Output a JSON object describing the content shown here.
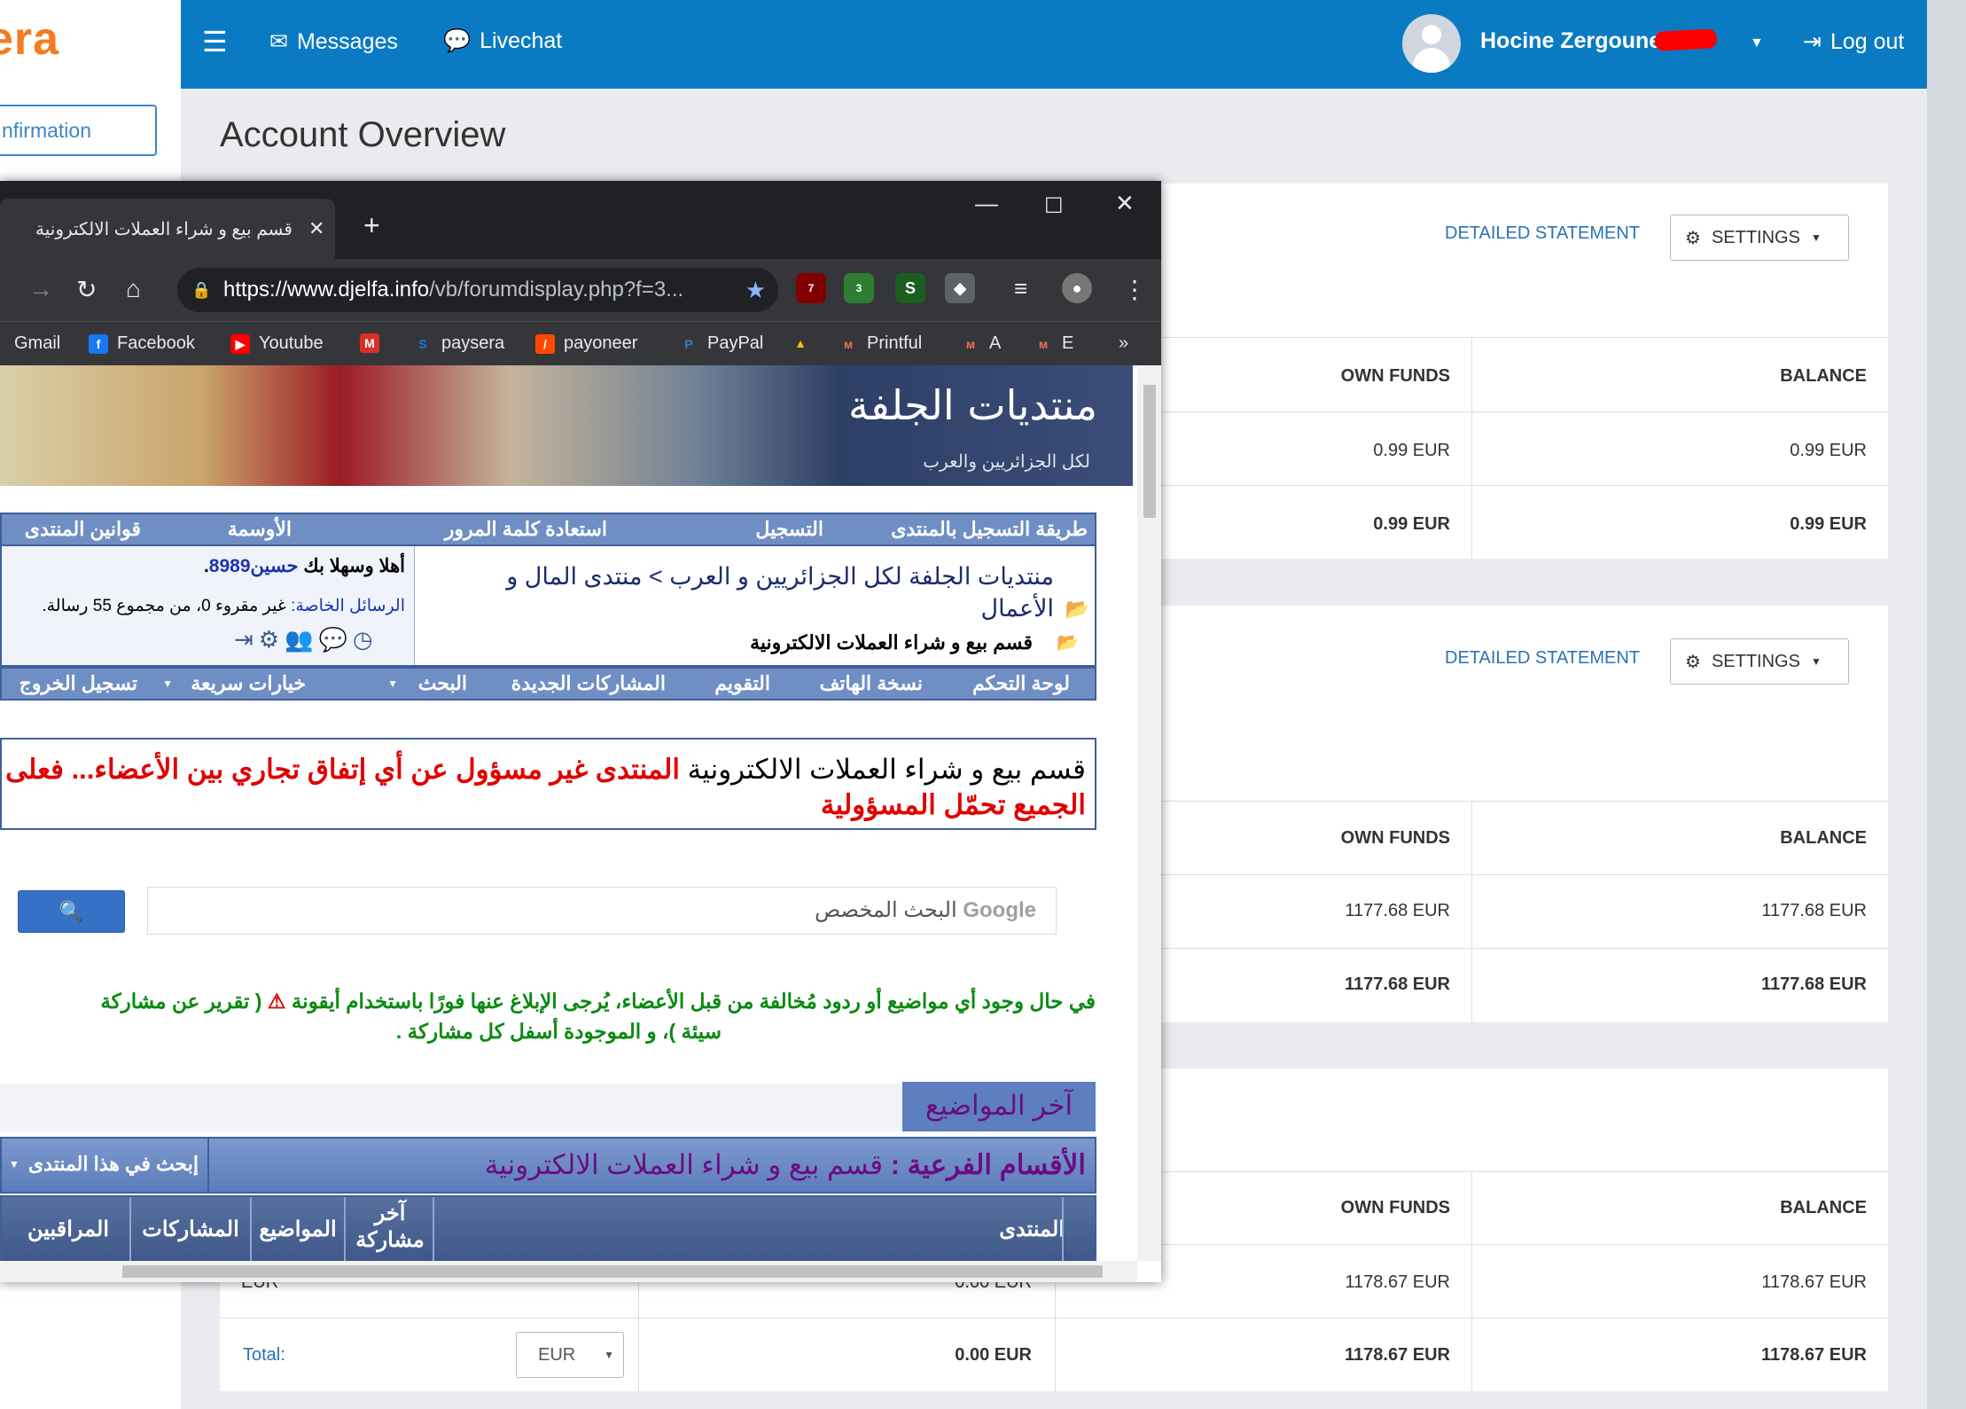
{
  "app": {
    "logo_text": "era",
    "confirm_label": "nfirmation",
    "nav": {
      "messages": "Messages",
      "livechat": "Livechat"
    },
    "user": {
      "name": "Hocine Zergoune"
    },
    "logout": "Log out",
    "page_title": "Account Overview"
  },
  "panels": [
    {
      "detailed": "DETAILED STATEMENT",
      "settings": "SETTINGS",
      "headers": {
        "own_funds": "OWN FUNDS",
        "balance": "BALANCE"
      },
      "rows": [
        {
          "own_funds": "0.99 EUR",
          "balance": "0.99 EUR"
        }
      ],
      "totals": {
        "own_funds": "0.99 EUR",
        "balance": "0.99 EUR"
      }
    },
    {
      "detailed": "DETAILED STATEMENT",
      "settings": "SETTINGS",
      "headers": {
        "own_funds": "OWN FUNDS",
        "balance": "BALANCE"
      },
      "rows": [
        {
          "own_funds": "1177.68 EUR",
          "balance": "1177.68 EUR"
        }
      ],
      "totals": {
        "own_funds": "1177.68 EUR",
        "balance": "1177.68 EUR"
      }
    },
    {
      "headers": {
        "own_funds": "OWN FUNDS",
        "balance": "BALANCE"
      },
      "rows": [
        {
          "currency": "EUR",
          "reserved": "0.00 EUR",
          "own_funds": "1178.67 EUR",
          "balance": "1178.67 EUR"
        }
      ],
      "totals": {
        "label": "Total:",
        "currency_select": "EUR",
        "reserved": "0.00 EUR",
        "own_funds": "1178.67 EUR",
        "balance": "1178.67 EUR"
      }
    }
  ],
  "browser": {
    "tab_title": "قسم بيع و شراء العملات الالكترونية",
    "url_host": "https://www.djelfa.info",
    "url_path": "/vb/forumdisplay.php?f=3...",
    "ext_badges": {
      "ublock": "7",
      "shield": "3"
    },
    "bookmarks": [
      "Gmail",
      "Facebook",
      "Youtube",
      "paysera",
      "payoneer",
      "PayPal",
      "Printful",
      "A",
      "E"
    ],
    "bookmarks_more": "»"
  },
  "forum": {
    "banner_logo": "منتديات الجلفة",
    "banner_sub": "لكل الجزائريين والعرب",
    "top_nav": [
      "طريقة التسجيل بالمنتدى",
      "التسجيل",
      "استعادة كلمة المرور",
      "الأوسمة",
      "قوانين المنتدى"
    ],
    "breadcrumb": "منتديات الجلفة لكل الجزائريين و العرب > منتدى المال و الأعمال",
    "current_forum": "قسم بيع و شراء العملات الالكترونية",
    "welcome_prefix": "أهلا وسهلا بك",
    "username": "حسين8989",
    "pm_label": "الرسائل الخاصة:",
    "pm_text": "غير مقروء 0، من مجموع 55 رسالة.",
    "second_nav": [
      "لوحة التحكم",
      "نسخة الهاتف",
      "التقويم",
      "المشاركات الجديدة",
      "البحث",
      "خيارات سريعة",
      "تسجيل الخروج"
    ],
    "rules_black": "قسم بيع و شراء العملات الالكترونية",
    "rules_red": "المنتدى غير مسؤول عن أي إتفاق تجاري بين الأعضاء... فعلى الجميع تحمّل المسؤولية",
    "search_placeholder": "البحث المخصص",
    "search_brand": "Google",
    "notice_line1": "في حال وجود أي مواضيع أو ردود مُخالفة من قبل الأعضاء، يُرجى الإبلاغ عنها فورًا باستخدام أيقونة",
    "notice_line1b": "( تقرير عن مشاركة",
    "notice_line2": "سيئة )، و الموجودة أسفل كل مشاركة .",
    "latest_topics": "آخر المواضيع",
    "subforums_prefix": "الأقسام الفرعية :",
    "subforums_name": "قسم بيع و شراء العملات الالكترونية",
    "search_forum": "إبحث في هذا المنتدى",
    "columns": {
      "forum": "المنتدى",
      "last_post": "آخر مشاركة",
      "topics": "المواضيع",
      "posts": "المشاركات",
      "moderators": "المراقبين"
    }
  },
  "colors": {
    "topbar": "#0a7bc3",
    "brand": "#f47b20",
    "link": "#2a72b5",
    "forum_nav": "#6f8fc4",
    "forum_red": "#e00000",
    "forum_green": "#0a8a12"
  }
}
